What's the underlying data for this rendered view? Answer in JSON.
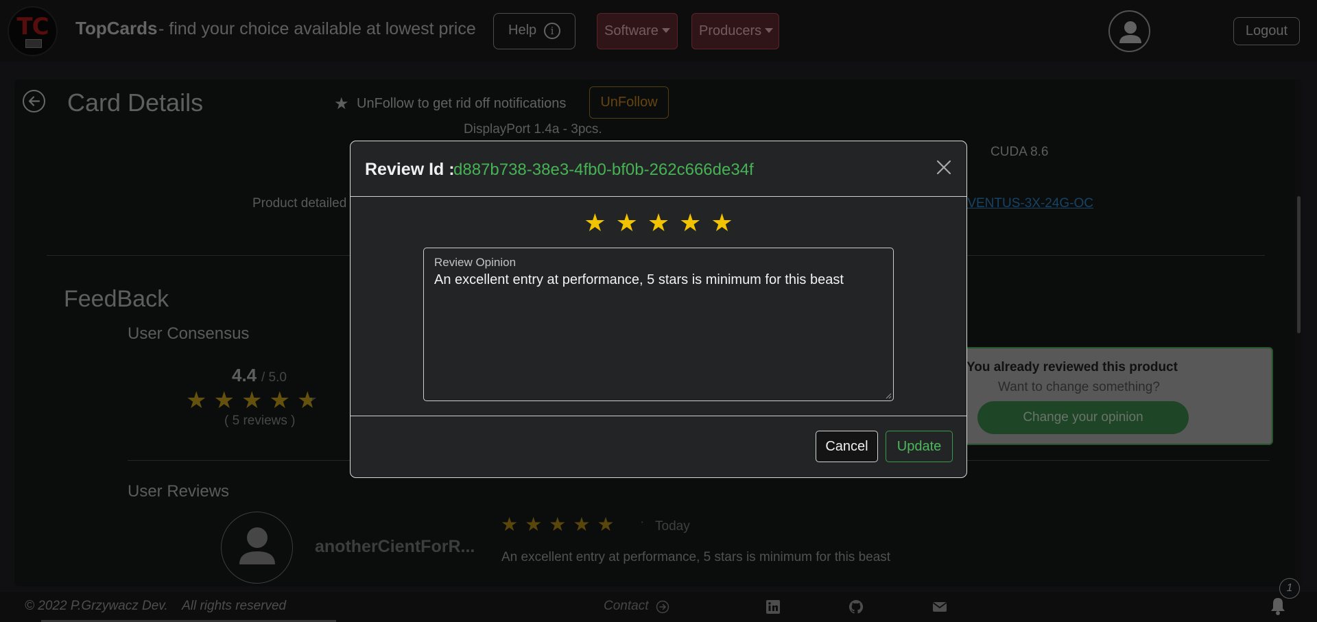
{
  "navbar": {
    "logo_text": "TC",
    "brand": "TopCards",
    "tagline": "- find your choice available at lowest price",
    "help_label": "Help",
    "help_icon": "info-icon",
    "software_label": "Software",
    "producers_label": "Producers",
    "logout_label": "Logout"
  },
  "page": {
    "title": "Card Details",
    "follow_text": "UnFollow to get rid off notifications",
    "unfollow_label": "UnFollow",
    "displayport_text": "DisplayPort 1.4a - 3pcs.",
    "cuda_text": "CUDA 8.6",
    "product_detail_label": "Product detailed",
    "product_link_fragment": "-VENTUS-3X-24G-OC"
  },
  "feedback": {
    "title": "FeedBack",
    "consensus_title": "User Consensus",
    "rating": "4.4",
    "rating_max": "/ 5.0",
    "rating_value": 4.4,
    "reviews_count": "( 5 reviews )",
    "reviewed_title": "You already reviewed this product",
    "reviewed_sub": "Want to change something?",
    "change_button": "Change your opinion",
    "user_reviews_title": "User Reviews",
    "reviews": [
      {
        "user": "anotherCientForR...",
        "stars": 5,
        "date": "Today",
        "text": "An excellent entry at performance, 5 stars is minimum for this beast"
      }
    ]
  },
  "footer": {
    "copyright": "© 2022 P.Grzywacz Dev.    All rights reserved",
    "contact": "Contact",
    "notification_count": "1"
  },
  "modal": {
    "title_label": "Review Id :",
    "review_id": "d887b738-38e3-4fb0-bf0b-262c666de34f",
    "stars_selected": 5,
    "textarea_label": "Review Opinion",
    "textarea_value": "An excellent entry at performance, 5 stars is minimum for this beast",
    "cancel_label": "Cancel",
    "update_label": "Update"
  },
  "colors": {
    "accent_green": "#46b354",
    "star_gold": "#f2c400",
    "dropdown_red": "#b8444f",
    "unfollow_orange": "#c88a25",
    "link_blue": "#2e86c9"
  }
}
